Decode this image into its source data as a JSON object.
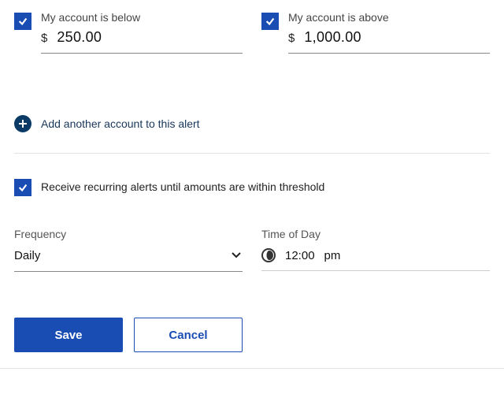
{
  "thresholds": {
    "below": {
      "checked": true,
      "label": "My account is below",
      "currency": "$",
      "amount": "250.00"
    },
    "above": {
      "checked": true,
      "label": "My account is above",
      "currency": "$",
      "amount": "1,000.00"
    }
  },
  "add_account_label": "Add another account to this alert",
  "recurring": {
    "checked": true,
    "label": "Receive recurring alerts until amounts are within threshold"
  },
  "frequency": {
    "label": "Frequency",
    "value": "Daily"
  },
  "time_of_day": {
    "label": "Time of Day",
    "time": "12:00",
    "meridiem": "pm"
  },
  "buttons": {
    "save": "Save",
    "cancel": "Cancel"
  }
}
